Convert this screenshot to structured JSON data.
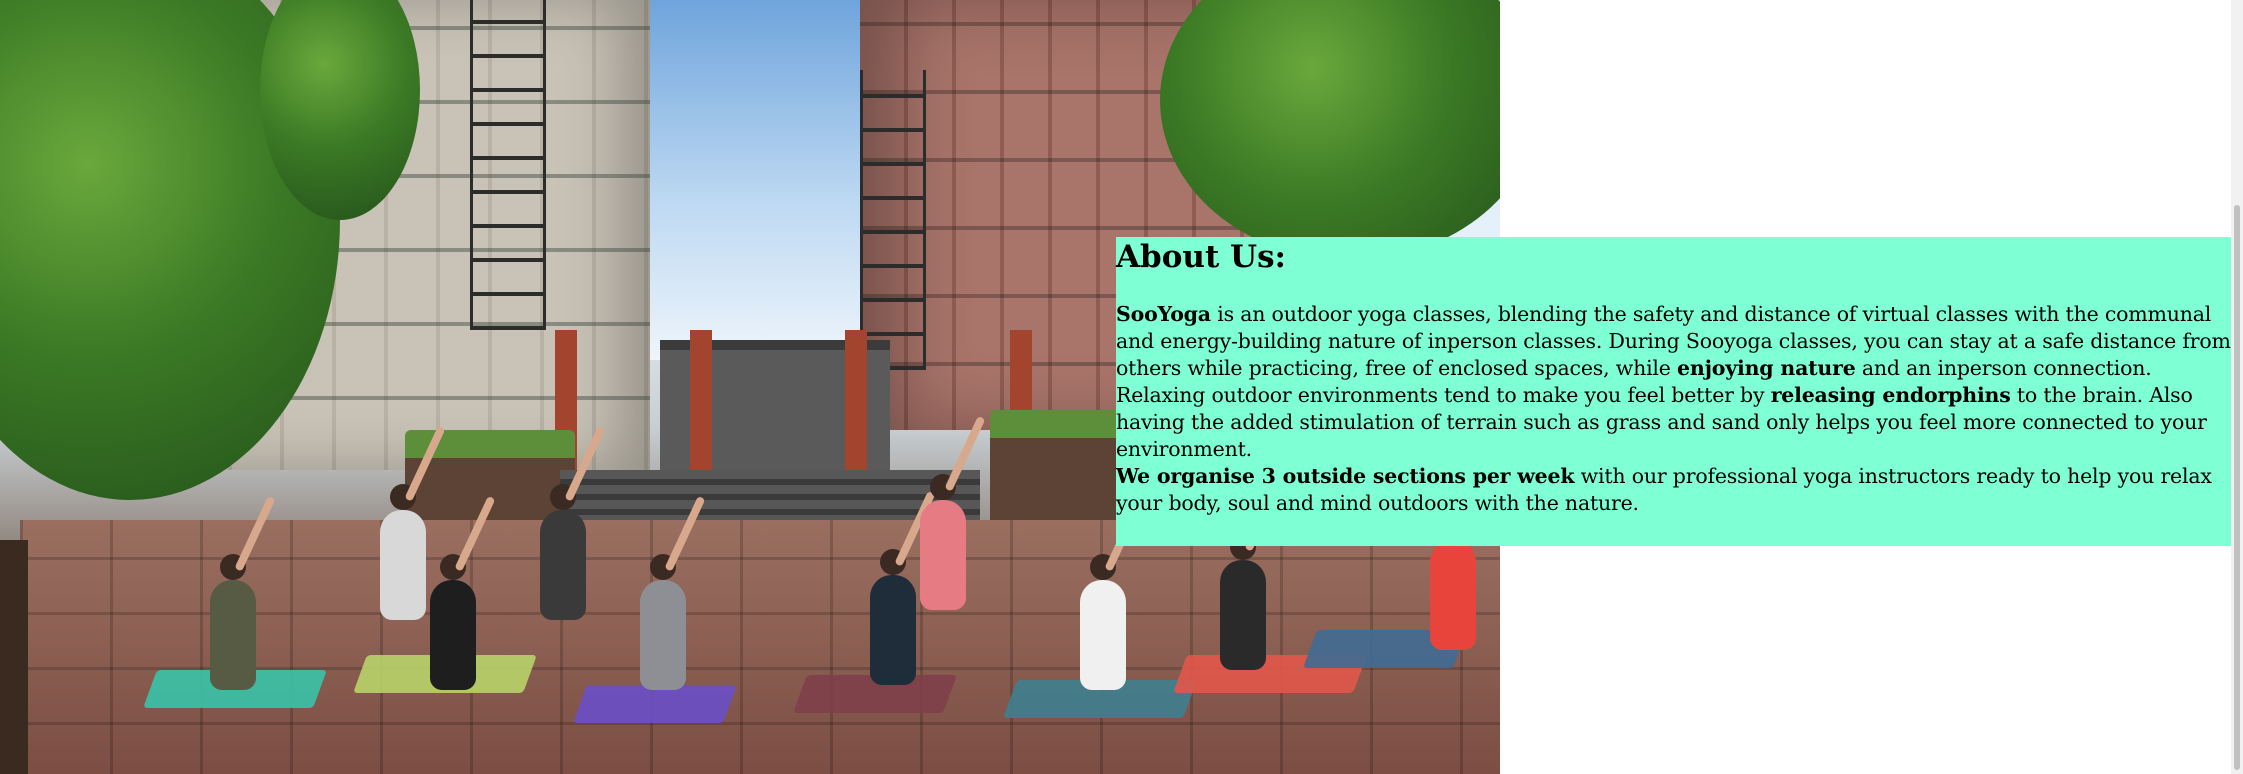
{
  "hero": {
    "image_alt": "Outdoor yoga class in an urban courtyard"
  },
  "about": {
    "heading": "About Us:",
    "paragraph1": {
      "brand": "SooYoga",
      "text1": " is an outdoor yoga classes, blending the safety and distance of virtual classes with the communal and energy-building nature of inperson classes. During Sooyoga classes, you can stay at a safe distance from others while practicing, free of enclosed spaces, while ",
      "bold": "enjoying nature",
      "text2": " and an inperson connection."
    },
    "paragraph2": {
      "text1": "Relaxing outdoor environments tend to make you feel better by ",
      "bold": "releasing endorphins",
      "text2": " to the brain. Also having the added stimulation of terrain such as grass and sand only helps you feel more connected to your environment."
    },
    "paragraph3": {
      "bold": "We organise 3 outside sections per week",
      "text": " with our professional yoga instructors ready to help you relax your body, soul and mind outdoors with the nature."
    },
    "background_color": "#7fffd4"
  }
}
